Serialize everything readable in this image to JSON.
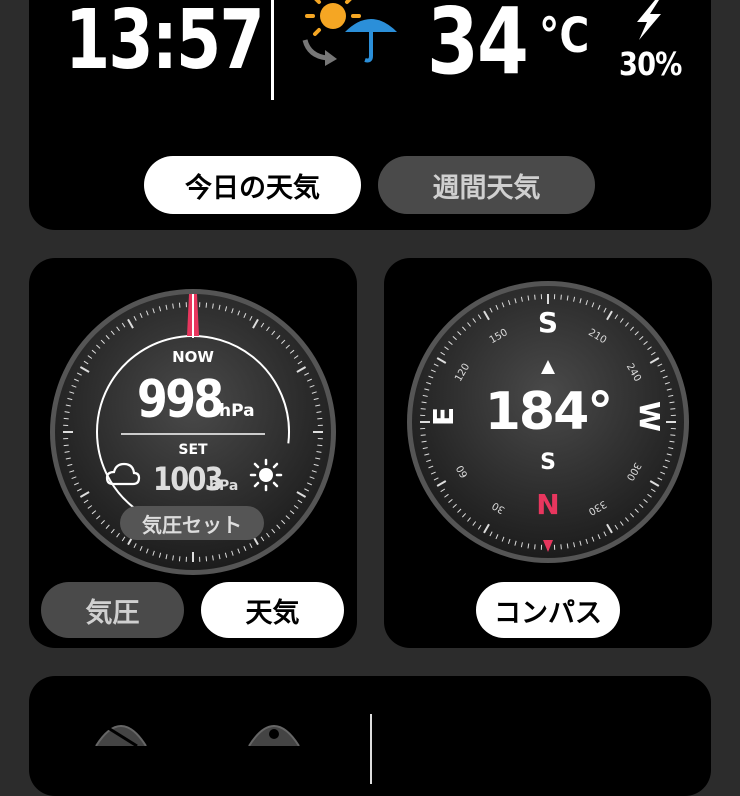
{
  "weather": {
    "time": "13:57",
    "temperature": "34",
    "temp_unit": "°C",
    "precip": "30%",
    "tabs": [
      {
        "label": "今日の天気",
        "active": true
      },
      {
        "label": "週間天気",
        "active": false
      }
    ]
  },
  "pressure": {
    "now_label": "NOW",
    "now_value": "998",
    "unit": "hPa",
    "set_label": "SET",
    "set_value": "1003",
    "set_button": "気圧セット",
    "buttons": {
      "pressure": "気圧",
      "weather": "天気"
    }
  },
  "compass": {
    "heading": "184°",
    "labels": {
      "top": "S",
      "bottom": "N",
      "left": "E",
      "right": "W",
      "center": "S"
    },
    "degree_labels": [
      "150",
      "210",
      "120",
      "240",
      "60",
      "300",
      "30",
      "330"
    ],
    "button": "コンパス"
  },
  "colors": {
    "accent": "#e8365e",
    "sun": "#f5a623",
    "umbrella": "#2b8fd9"
  }
}
